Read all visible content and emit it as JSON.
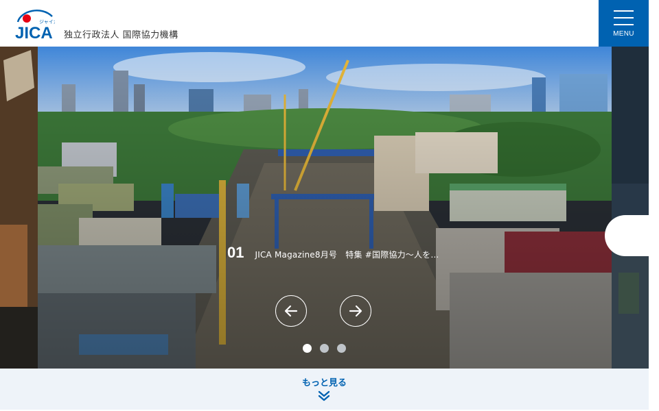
{
  "header": {
    "logo_text": "JICA",
    "logo_kana": "ジャイカ",
    "org_name": "独立行政法人 国際協力機構",
    "menu_label": "MENU"
  },
  "hero": {
    "slide_number": "01",
    "slide_title": "JICA Magazine8月号　特集 #国際協力〜人を…",
    "dots": [
      {
        "active": true
      },
      {
        "active": false
      },
      {
        "active": false
      }
    ]
  },
  "more": {
    "label": "もっと見る"
  },
  "colors": {
    "brand_blue": "#0062b1",
    "brand_red": "#e60012",
    "more_bg": "#eef3f9"
  },
  "icons": [
    "hamburger-icon",
    "arrow-left-icon",
    "arrow-right-icon",
    "double-chevron-down-icon"
  ]
}
